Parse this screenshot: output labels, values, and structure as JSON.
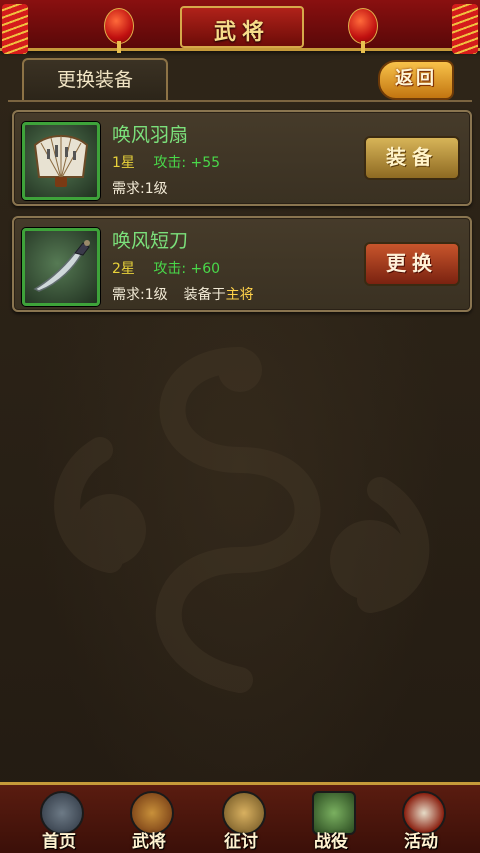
{
  "header": {
    "title": "武将"
  },
  "tab": {
    "label": "更换装备"
  },
  "back_button": {
    "label": "返回"
  },
  "items": [
    {
      "name": "唤风羽扇",
      "stars": "1星",
      "attack_label": "攻击:",
      "attack_value": "+55",
      "requirement": "需求:1级",
      "equipped_prefix": "",
      "equipped_to": "",
      "button_label": "装备",
      "icon": "folding-fan-icon"
    },
    {
      "name": "唤风短刀",
      "stars": "2星",
      "attack_label": "攻击:",
      "attack_value": "+60",
      "requirement": "需求:1级",
      "equipped_prefix": "装备于",
      "equipped_to": "主将",
      "button_label": "更换",
      "icon": "short-blade-icon"
    }
  ],
  "nav": [
    {
      "label": "首页",
      "icon": "home-icon"
    },
    {
      "label": "武将",
      "icon": "general-icon"
    },
    {
      "label": "征讨",
      "icon": "campaign-icon"
    },
    {
      "label": "战役",
      "icon": "battle-scroll-icon"
    },
    {
      "label": "活动",
      "icon": "drum-icon"
    }
  ],
  "colors": {
    "header_red": "#8a1010",
    "gold": "#c69a3a",
    "item_name_green": "#7be07b",
    "attack_green": "#49d84a",
    "star_yellow": "#e8d23a",
    "general_yellow": "#ffd24a"
  }
}
